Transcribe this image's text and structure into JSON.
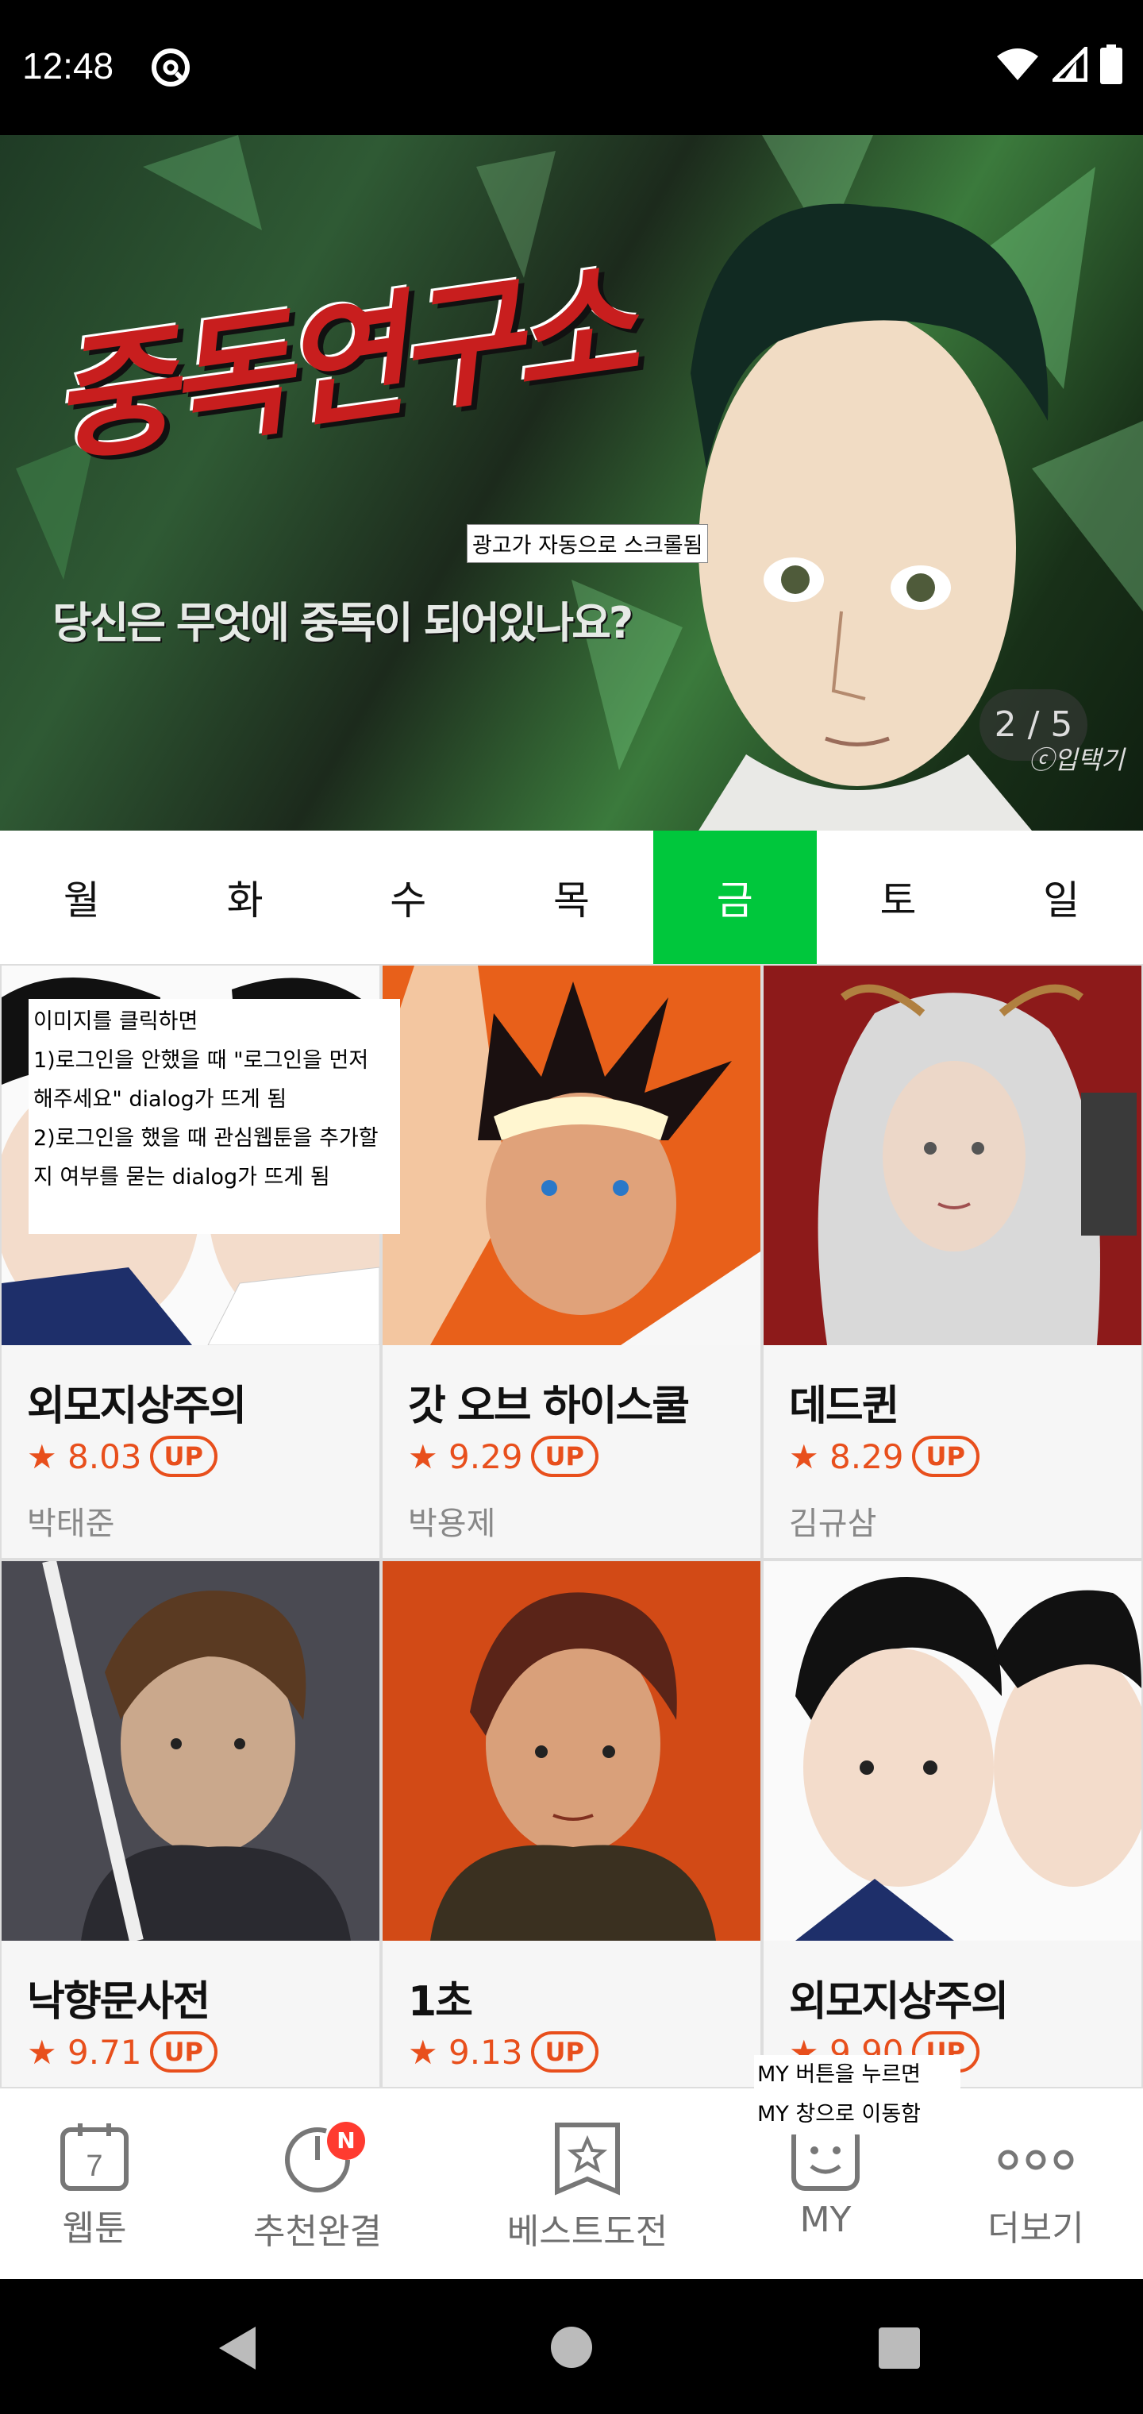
{
  "status_bar": {
    "time": "12:48"
  },
  "banner": {
    "title": "중독연구소",
    "subtitle": "당신은 무엇에 중독이 되어있나요?",
    "note": "광고가 자동으로 스크롤됨",
    "counter": "2 / 5",
    "credit": "ⓒ입택기"
  },
  "day_tabs": [
    "월",
    "화",
    "수",
    "목",
    "금",
    "토",
    "일"
  ],
  "active_day": "금",
  "image_click_note": "이미지를 클릭하면 1)로그인을 안했을 때 \"로그인을 먼저 해주세요\" dialog가 뜨게 됨 2)로그인을 했을 때 관심웹툰을 추가할 지 여부를 묻는 dialog가 뜨게 됨",
  "image_click_note_lines": [
    "이미지를 클릭하면",
    "1)로그인을 안했을 때 \"로그인을 먼저",
    "해주세요\" dialog가 뜨게 됨",
    "2)로그인을 했을 때 관심웹툰을 추가할",
    "지 여부를 묻는 dialog가 뜨게 됨"
  ],
  "webtoons": [
    {
      "title": "외모지상주의",
      "rating": "★ 8.03",
      "badge": "UP",
      "author": "박태준"
    },
    {
      "title": "갓 오브 하이스쿨",
      "rating": "★ 9.29",
      "badge": "UP",
      "author": "박용제"
    },
    {
      "title": "데드퀸",
      "rating": "★ 8.29",
      "badge": "UP",
      "author": "김규삼"
    },
    {
      "title": "낙향문사전",
      "rating": "★ 9.71",
      "badge": "UP",
      "author": ""
    },
    {
      "title": "1초",
      "rating": "★ 9.13",
      "badge": "UP",
      "author": ""
    },
    {
      "title": "외모지상주의",
      "rating": "★ 9.90",
      "badge": "UP",
      "author": ""
    }
  ],
  "bottom_nav": {
    "webtoon": "웹툰",
    "webtoon_icon_number": "7",
    "recommend": "추천완결",
    "recommend_badge": "N",
    "best": "베스트도전",
    "my": "MY",
    "more": "더보기"
  },
  "my_note_lines": [
    "MY 버튼을 누르면",
    "MY 창으로 이동함"
  ],
  "colors": {
    "accent_green": "#00c73c",
    "rating_orange": "#e84f1c",
    "badge_red": "#ff3b30"
  }
}
